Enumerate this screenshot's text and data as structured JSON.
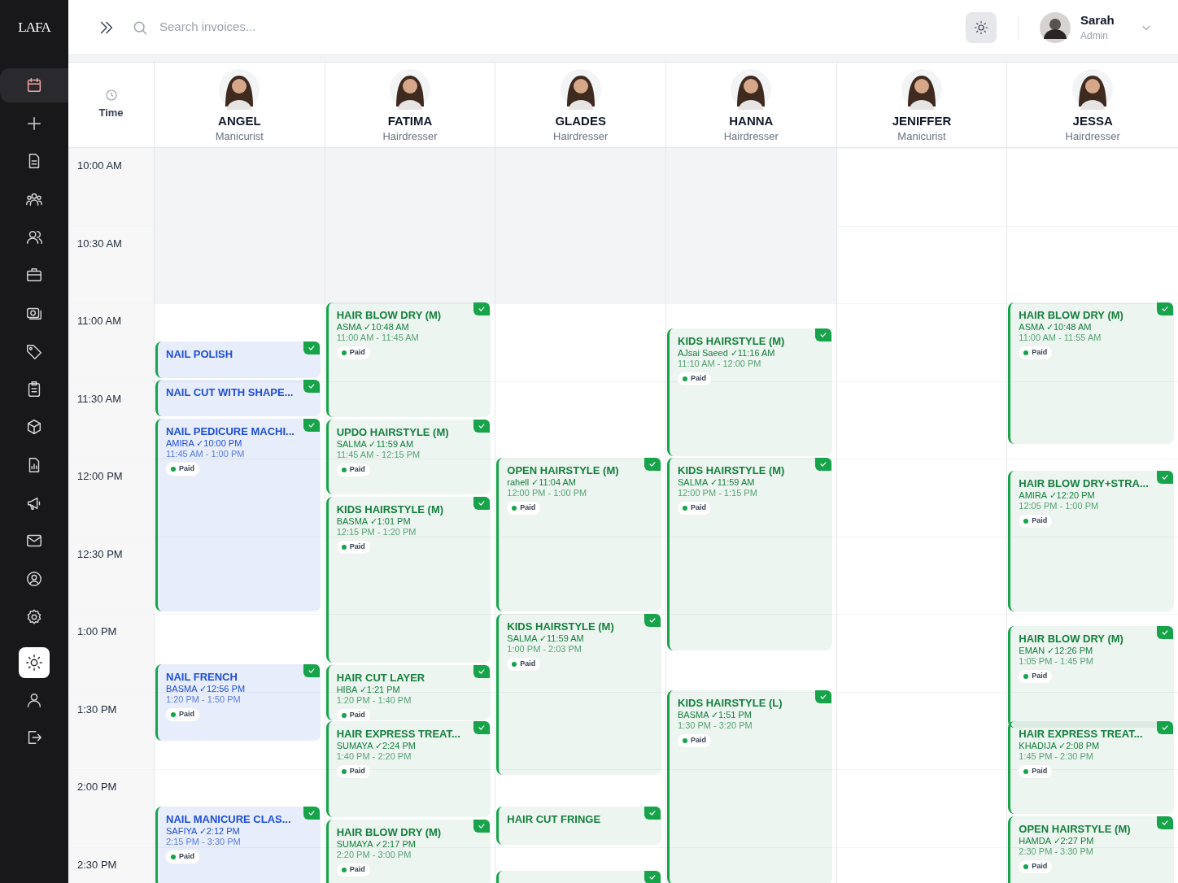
{
  "sidebar": {
    "logo": "LAFA",
    "items": [
      {
        "kind": "calendar",
        "selected": true
      },
      {
        "kind": "plus",
        "selected": false
      },
      {
        "kind": "document",
        "selected": false
      },
      {
        "kind": "group",
        "selected": false
      },
      {
        "kind": "users",
        "selected": false
      },
      {
        "kind": "briefcase",
        "selected": false
      },
      {
        "kind": "camera",
        "selected": false
      },
      {
        "kind": "tag",
        "selected": false
      },
      {
        "kind": "clipboard",
        "selected": false
      },
      {
        "kind": "box",
        "selected": false
      },
      {
        "kind": "report",
        "selected": false
      },
      {
        "kind": "megaphone",
        "selected": false
      },
      {
        "kind": "mail",
        "selected": false
      },
      {
        "kind": "user-circle",
        "selected": false
      },
      {
        "kind": "settings",
        "selected": false
      }
    ],
    "bottom": [
      {
        "kind": "sun",
        "selected": true
      },
      {
        "kind": "user",
        "selected": false
      },
      {
        "kind": "logout",
        "selected": false
      }
    ]
  },
  "header": {
    "search": {
      "placeholder": "Search invoices..."
    },
    "user": {
      "name": "Sarah",
      "role": "Admin"
    }
  },
  "calendar": {
    "time_heading": "Time",
    "times": [
      "10:00 AM",
      "10:30 AM",
      "11:00 AM",
      "11:30 AM",
      "12:00 PM",
      "12:30 PM",
      "1:00 PM",
      "1:30 PM",
      "2:00 PM",
      "2:30 PM"
    ],
    "staff": [
      {
        "name": "ANGEL",
        "role": "Manicurist",
        "closed_before_11": true,
        "events": [
          {
            "title": "NAIL POLISH",
            "color": "#1d4ed8",
            "confirmed": true
          },
          {
            "title": "NAIL CUT WITH SHAPE...",
            "color": "#1d4ed8",
            "confirmed": true
          },
          {
            "title": "NAIL PEDICURE MACHI...",
            "client": "AMIRA ✓10:00 PM",
            "time": "11:45 AM - 1:00 PM",
            "payment": "Paid",
            "color": "#1d4ed8",
            "confirmed": true
          },
          {
            "title": "NAIL FRENCH",
            "client": "BASMA ✓12:56 PM",
            "time": "1:20 PM - 1:50 PM",
            "payment": "Paid",
            "color": "#1d4ed8",
            "confirmed": true
          },
          {
            "title": "NAIL MANICURE CLAS...",
            "client": "SAFIYA ✓2:12 PM",
            "time": "2:15 PM - 3:30 PM",
            "payment": "Paid",
            "color": "#1d4ed8",
            "confirmed": true
          }
        ]
      },
      {
        "name": "FATIMA",
        "role": "Hairdresser",
        "closed_before_11": true,
        "events": [
          {
            "title": "HAIR BLOW DRY (M)",
            "client": "ASMA ✓10:48 AM",
            "time": "11:00 AM - 11:45 AM",
            "payment": "Paid",
            "color": "#15803d",
            "confirmed": true
          },
          {
            "title": "UPDO HAIRSTYLE (M)",
            "client": "SALMA ✓11:59 AM",
            "time": "11:45 AM - 12:15 PM",
            "payment": "Paid",
            "color": "#15803d",
            "confirmed": true
          },
          {
            "title": "KIDS HAIRSTYLE (M)",
            "client": "BASMA ✓1:01 PM",
            "time": "12:15 PM - 1:20 PM",
            "payment": "Paid",
            "color": "#15803d",
            "confirmed": true
          },
          {
            "title": "HAIR CUT LAYER",
            "client": "HIBA ✓1:21 PM",
            "time": "1:20 PM - 1:40 PM",
            "payment": "Paid",
            "color": "#15803d",
            "confirmed": true
          },
          {
            "title": "HAIR EXPRESS TREAT...",
            "client": "SUMAYA ✓2:24 PM",
            "time": "1:40 PM - 2:20 PM",
            "payment": "Paid",
            "color": "#15803d",
            "confirmed": true
          },
          {
            "title": "HAIR BLOW DRY (M)",
            "client": "SUMAYA ✓2:17 PM",
            "time": "2:20 PM - 3:00 PM",
            "payment": "Paid",
            "color": "#15803d",
            "confirmed": true
          }
        ]
      },
      {
        "name": "GLADES",
        "role": "Hairdresser",
        "closed_before_11": true,
        "events": [
          {
            "title": "OPEN HAIRSTYLE (M)",
            "client": "rahell ✓11:04 AM",
            "time": "12:00 PM - 1:00 PM",
            "payment": "Paid",
            "color": "#15803d",
            "confirmed": true
          },
          {
            "title": "KIDS HAIRSTYLE (M)",
            "client": "SALMA ✓11:59 AM",
            "time": "1:00 PM - 2:03 PM",
            "payment": "Paid",
            "color": "#15803d",
            "confirmed": true
          },
          {
            "title": "HAIR CUT FRINGE",
            "color": "#15803d",
            "confirmed": true
          },
          {
            "confirmed": true
          }
        ]
      },
      {
        "name": "HANNA",
        "role": "Hairdresser",
        "closed_before_11": true,
        "events": [
          {
            "title": "KIDS HAIRSTYLE (M)",
            "client": "AJsai Saeed ✓11:16 AM",
            "time": "11:10 AM - 12:00 PM",
            "payment": "Paid",
            "color": "#15803d",
            "confirmed": true
          },
          {
            "title": "KIDS HAIRSTYLE (M)",
            "client": "SALMA ✓11:59 AM",
            "time": "12:00 PM - 1:15 PM",
            "payment": "Paid",
            "color": "#15803d",
            "confirmed": true
          },
          {
            "title": "KIDS HAIRSTYLE (L)",
            "client": "BASMA ✓1:51 PM",
            "time": "1:30 PM - 3:20 PM",
            "payment": "Paid",
            "color": "#15803d",
            "confirmed": true
          }
        ]
      },
      {
        "name": "JENIFFER",
        "role": "Manicurist",
        "closed_before_11": false
      },
      {
        "name": "JESSA",
        "role": "Hairdresser",
        "closed_before_11": false,
        "events": [
          {
            "title": "HAIR BLOW DRY (M)",
            "client": "ASMA ✓10:48 AM",
            "time": "11:00 AM - 11:55 AM",
            "payment": "Paid",
            "color": "#15803d",
            "confirmed": true
          },
          {
            "title": "HAIR BLOW DRY+STRA...",
            "client": "AMIRA ✓12:20 PM",
            "time": "12:05 PM - 1:00 PM",
            "payment": "Paid",
            "color": "#15803d",
            "confirmed": true
          },
          {
            "title": "HAIR BLOW DRY (M)",
            "client": "EMAN ✓12:26 PM",
            "time": "1:05 PM - 1:45 PM",
            "payment": "Paid",
            "color": "#15803d",
            "confirmed": true
          },
          {
            "title": "HAIR EXPRESS TREAT...",
            "client": "KHADIJA ✓2:08 PM",
            "time": "1:45 PM - 2:30 PM",
            "payment": "Paid",
            "color": "#15803d",
            "confirmed": true
          },
          {
            "title": "OPEN HAIRSTYLE (M)",
            "client": "HAMDA ✓2:27 PM",
            "time": "2:30 PM - 3:30 PM",
            "payment": "Paid",
            "color": "#15803d",
            "confirmed": true
          }
        ]
      }
    ]
  }
}
